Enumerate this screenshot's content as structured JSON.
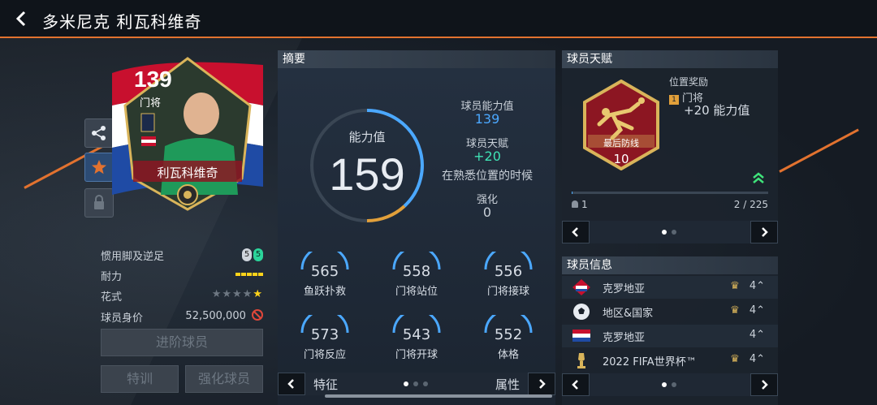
{
  "header": {
    "title": "多米尼克 利瓦科维奇"
  },
  "card": {
    "rating": "139",
    "position": "门将",
    "name": "利瓦科维奇"
  },
  "player_info": {
    "foot_label": "惯用脚及逆足",
    "foot_main": "5",
    "foot_weak": "5",
    "stamina_label": "耐力",
    "skill_label": "花式",
    "skill_stars": 5,
    "value_label": "球员身价",
    "value": "52,500,000"
  },
  "buttons": {
    "advance": "进阶球员",
    "training": "特训",
    "enhance": "强化球员"
  },
  "summary": {
    "title": "摘要",
    "ring_label": "能力值",
    "ring_value": "159",
    "ability_label": "球员能力值",
    "ability_value": "139",
    "talent_label": "球员天赋",
    "talent_value": "+20",
    "talent_note": "在熟悉位置的时候",
    "enhance_label": "强化",
    "enhance_value": "0",
    "stats": [
      {
        "value": "565",
        "label": "鱼跃扑救"
      },
      {
        "value": "558",
        "label": "门将站位"
      },
      {
        "value": "556",
        "label": "门将接球"
      },
      {
        "value": "573",
        "label": "门将反应"
      },
      {
        "value": "543",
        "label": "门将开球"
      },
      {
        "value": "552",
        "label": "体格"
      }
    ],
    "nav_left": "特征",
    "nav_right": "属性"
  },
  "talent": {
    "title": "球员天赋",
    "badge_name": "最后防线",
    "badge_level": "10",
    "bonus_title": "位置奖励",
    "bonus_pos": "门将",
    "bonus_value": "+20 能力值",
    "progress_left": "1",
    "progress_right": "2 / 225",
    "progress_fraction": 0.004
  },
  "player_list": {
    "title": "球员信息",
    "rows": [
      {
        "name": "克罗地亚",
        "count": "4"
      },
      {
        "name": "地区&国家",
        "count": "4"
      },
      {
        "name": "克罗地亚",
        "count": "4"
      },
      {
        "name": "2022 FIFA世界杯™",
        "count": "4"
      }
    ]
  },
  "colors": {
    "accent_orange": "#e2722f",
    "ring_blue": "#4ba8ff",
    "talent_green": "#3fe3b5",
    "badge_red": "#8c1622",
    "gold": "#d9b45a"
  }
}
